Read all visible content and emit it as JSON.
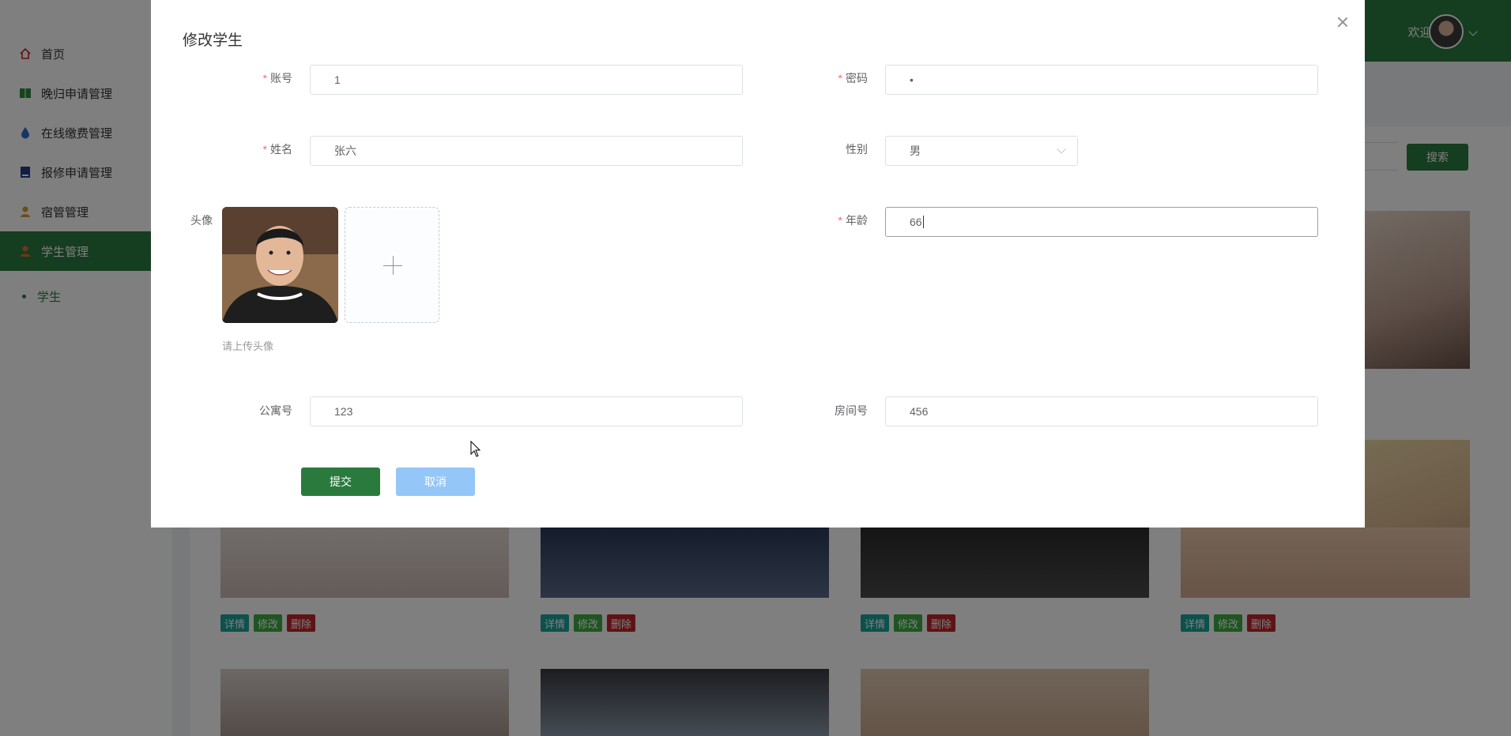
{
  "sidebar": {
    "items": [
      {
        "label": "首页",
        "icon": "home-icon"
      },
      {
        "label": "晚归申请管理",
        "icon": "book-icon"
      },
      {
        "label": "在线缴费管理",
        "icon": "drop-icon"
      },
      {
        "label": "报修申请管理",
        "icon": "clipboard-icon"
      },
      {
        "label": "宿管管理",
        "icon": "person-icon"
      },
      {
        "label": "学生管理",
        "icon": "student-icon"
      }
    ],
    "sub_item": "学生"
  },
  "header": {
    "welcome": "欢迎 2"
  },
  "toolbar": {
    "search_label": "搜索"
  },
  "cards": {
    "detail_label": "详情",
    "edit_label": "修改",
    "delete_label": "删除"
  },
  "modal": {
    "title": "修改学生",
    "fields": {
      "account": {
        "label": "账号",
        "value": "1",
        "required": true
      },
      "password": {
        "label": "密码",
        "value": "•",
        "required": true
      },
      "name": {
        "label": "姓名",
        "value": "张六",
        "required": true
      },
      "gender": {
        "label": "性别",
        "value": "男"
      },
      "avatar": {
        "label": "头像",
        "hint": "请上传头像"
      },
      "age": {
        "label": "年龄",
        "value": "66",
        "required": true
      },
      "apartment": {
        "label": "公寓号",
        "value": "123"
      },
      "room": {
        "label": "房间号",
        "value": "456"
      }
    },
    "submit_label": "提交",
    "cancel_label": "取消"
  },
  "colors": {
    "primary": "#2a7a3e",
    "danger": "#c0262d",
    "cancel": "#94c6f7"
  }
}
